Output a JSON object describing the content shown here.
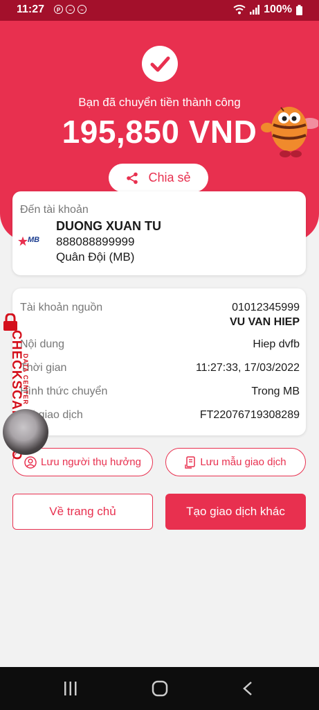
{
  "status_bar": {
    "time": "11:27",
    "battery": "100%"
  },
  "hero": {
    "title": "Bạn đã chuyển tiền thành công",
    "amount": "195,850 VND",
    "share_label": "Chia sẻ"
  },
  "recipient": {
    "label": "Đến tài khoản",
    "bank_logo_text": "MB",
    "name": "DUONG XUAN TU",
    "account": "888088899999",
    "bank": "Quân Đội (MB)"
  },
  "details": {
    "source_label": "Tài khoản nguồn",
    "source_account": "01012345999",
    "sender_name": "VU VAN HIEP",
    "content_label": "Nội dung",
    "content_value": "Hiep dvfb",
    "time_label": "Thời gian",
    "time_value": "11:27:33, 17/03/2022",
    "method_label": "Hình thức chuyển",
    "method_value": "Trong MB",
    "txn_label": "Mã giao dịch",
    "txn_value": "FT22076719308289"
  },
  "actions": {
    "save_beneficiary": "Lưu người thụ hưởng",
    "save_template": "Lưu mẫu giao dịch",
    "home": "Về trang chủ",
    "new_transaction": "Tạo giao dịch khác"
  },
  "watermark": {
    "brand": "CHECKSCAM.INFO",
    "sub": "DATA CENTER"
  },
  "colors": {
    "primary": "#e8304f",
    "status_bar": "#a3102b",
    "watermark": "#d4101c"
  }
}
